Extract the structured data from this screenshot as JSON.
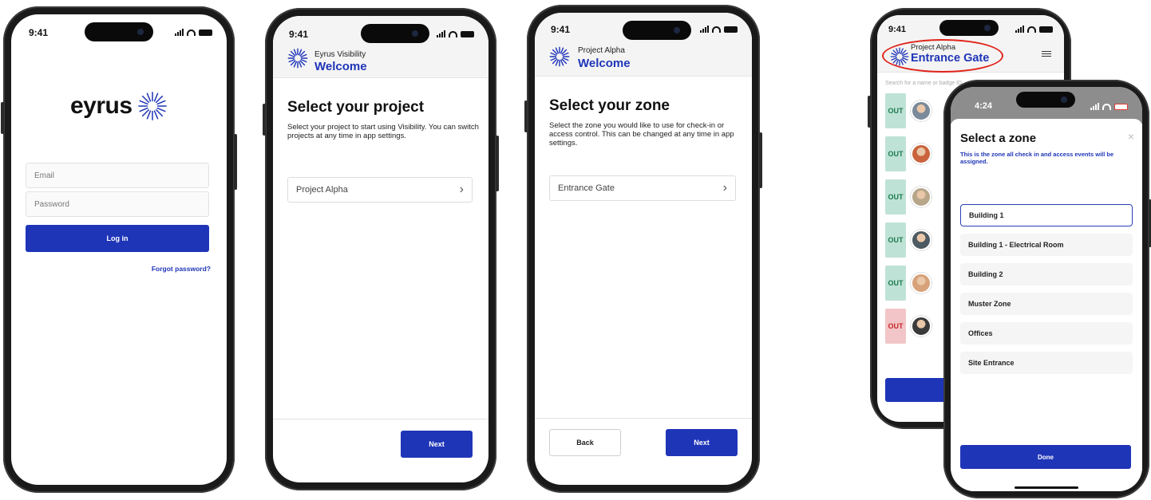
{
  "colors": {
    "brand_blue": "#1f35b8",
    "out_green": "#bfe2d6",
    "out_red": "#f2c6c8",
    "highlight_red": "#e0241b"
  },
  "login": {
    "time": "9:41",
    "logo_text": "eyrus",
    "email_placeholder": "Email",
    "password_placeholder": "Password",
    "login_button": "Log in",
    "forgot_link": "Forgot password?"
  },
  "project": {
    "time": "9:41",
    "header_sub": "Eyrus Visibility",
    "header_title": "Welcome",
    "heading": "Select your project",
    "description": "Select your project to start using Visibility. You can switch projects at any time in app settings.",
    "selected_value": "Project Alpha",
    "next_button": "Next"
  },
  "zone": {
    "time": "9:41",
    "header_sub": "Project Alpha",
    "header_title": "Welcome",
    "heading": "Select your zone",
    "description": "Select the zone you would like to use for check-in or access control. This can be changed at any time in app settings.",
    "selected_value": "Entrance Gate",
    "back_button": "Back",
    "next_button": "Next"
  },
  "list_phone": {
    "time": "9:41",
    "header_sub": "Project Alpha",
    "header_title": "Entrance Gate",
    "search_placeholder": "Search for a name or badge ID",
    "rows": [
      {
        "status": "OUT",
        "type": "out"
      },
      {
        "status": "OUT",
        "type": "out"
      },
      {
        "status": "OUT",
        "type": "out"
      },
      {
        "status": "OUT",
        "type": "out"
      },
      {
        "status": "OUT",
        "type": "out"
      },
      {
        "status": "OUT",
        "type": "alert"
      }
    ]
  },
  "zone_modal": {
    "time": "4:24",
    "title": "Select a zone",
    "close": "×",
    "subtitle": "This is the zone all check in and access events will be assigned.",
    "zones": [
      "Building 1",
      "Building 1 - Electrical Room",
      "Building 2",
      "Muster Zone",
      "Offices",
      "Site Entrance"
    ],
    "selected_index": 0,
    "done_button": "Done"
  }
}
